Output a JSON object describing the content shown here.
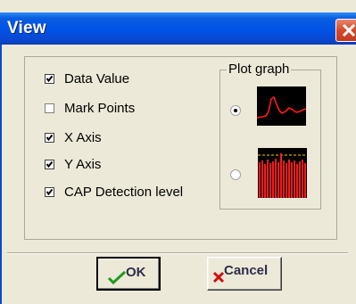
{
  "window": {
    "title": "View"
  },
  "options": [
    {
      "label": "Data Value",
      "checked": true
    },
    {
      "label": "Mark Points",
      "checked": false
    },
    {
      "label": "X Axis",
      "checked": true
    },
    {
      "label": "Y Axis",
      "checked": true
    },
    {
      "label": "CAP Detection level",
      "checked": true
    }
  ],
  "plot_graph": {
    "legend": "Plot graph",
    "choices": [
      {
        "thumbnail": "line-plot-icon",
        "selected": true
      },
      {
        "thumbnail": "bar-plot-icon",
        "selected": false
      }
    ]
  },
  "buttons": {
    "ok": "OK",
    "cancel": "Cancel"
  },
  "colors": {
    "plot_trace": "#ff1a1a",
    "plot_background": "#000000",
    "title_bar": "#0052e6"
  }
}
